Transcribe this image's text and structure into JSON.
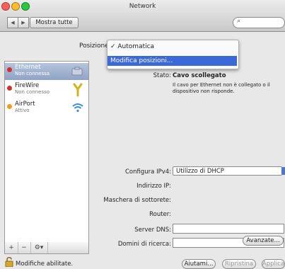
{
  "window": {
    "title": "Network"
  },
  "toolbar": {
    "back_icon": "arrow-left-icon",
    "forward_icon": "arrow-right-icon",
    "show_all_label": "Mostra tutte",
    "search_icon": "search-icon"
  },
  "location": {
    "label": "Posizione",
    "selected": "Automatica",
    "menu_items": [
      "✓ Automatica",
      "Modifica posizioni..."
    ]
  },
  "sidebar": {
    "items": [
      {
        "name": "Ethernet",
        "status": "Non connessa",
        "status_color": "#d0322b",
        "icon": "ethernet-icon"
      },
      {
        "name": "FireWire",
        "status": "Non connesso",
        "status_color": "#d0322b",
        "icon": "firewire-icon"
      },
      {
        "name": "AirPort",
        "status": "Attivo",
        "status_color": "#e5a11a",
        "icon": "wifi-icon"
      }
    ],
    "add_label": "+",
    "remove_label": "−",
    "action_label": "⚙▾"
  },
  "details": {
    "status_label": "Stato:",
    "status_value": "Cavo scollegato",
    "status_desc_1": "Il cavo per Ethernet non è collegato o il",
    "status_desc_2": "dispositivo non risponde.",
    "ipv4_label": "Configura IPv4:",
    "ipv4_value": "Utilizzo di DHCP",
    "ip_label": "Indirizzo IP:",
    "mask_label": "Maschera di sottorete:",
    "router_label": "Router:",
    "dns_label": "Server DNS:",
    "search_domains_label": "Domini di ricerca:",
    "advanced_label": "Avanzate..."
  },
  "footer": {
    "lock_text": "Modifiche abilitate.",
    "help_label": "Aiutami...",
    "revert_label": "Ripristina",
    "apply_label": "Applica"
  },
  "colors": {
    "accent": "#3b69d9",
    "selection": "#8ea3c6"
  }
}
